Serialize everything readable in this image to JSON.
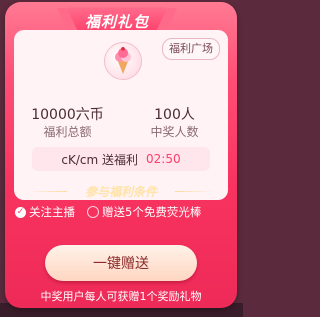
{
  "panel": {
    "title": "福利礼包",
    "plaza_label": "福利广场",
    "gift_icon": "ice-cream-gift-icon"
  },
  "stats": {
    "total_value": "10000六币",
    "total_label": "福利总额",
    "winners_value": "100人",
    "winners_label": "中奖人数"
  },
  "timer": {
    "keyword": "cK/cm 送福利",
    "countdown": "02:50"
  },
  "conditions": {
    "title": "参与福利条件",
    "items": [
      {
        "label": "关注主播",
        "checked": true
      },
      {
        "label": "赠送5个免费荧光棒",
        "checked": false
      }
    ]
  },
  "action": {
    "button_label": "一键赠送",
    "note": "中奖用户每人可获赠1个奖励礼物"
  },
  "colors": {
    "accent": "#ff3c6a",
    "panel_bg": "#fff3f5"
  }
}
